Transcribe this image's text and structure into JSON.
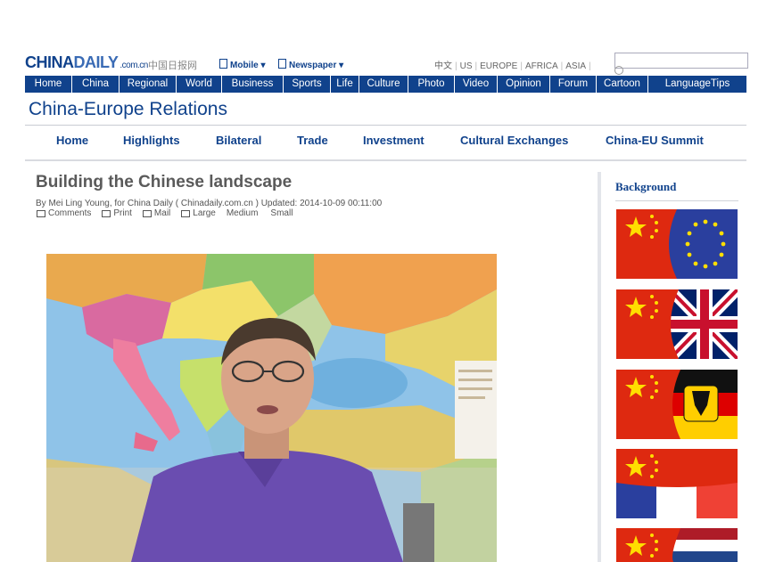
{
  "header": {
    "logo_main": "CHINA",
    "logo_daily": "DAILY",
    "logo_suffix": ".com.cn",
    "logo_chinese": "中国日报网",
    "mobile_label": "Mobile ▾",
    "newspaper_label": "Newspaper ▾",
    "regions": [
      "中文",
      "US",
      "EUROPE",
      "AFRICA",
      "ASIA"
    ],
    "search_placeholder": ""
  },
  "nav": {
    "items": [
      "Home",
      "China",
      "Regional",
      "World",
      "Business",
      "Sports",
      "Life",
      "Culture",
      "Photo",
      "Video",
      "Opinion",
      "Forum",
      "Cartoon",
      "LanguageTips"
    ]
  },
  "section": {
    "title": "China-Europe Relations",
    "subnav": [
      "Home",
      "Highlights",
      "Bilateral",
      "Trade",
      "Investment",
      "Cultural Exchanges",
      "China-EU Summit"
    ]
  },
  "article": {
    "headline": "Building the Chinese landscape",
    "byline": "By Mei Ling Young, for China Daily ( Chinadaily.com.cn ) Updated: 2014-10-09 00:11:00",
    "tools": [
      "Comments",
      "Print",
      "Mail"
    ],
    "font_sizes": [
      "Large",
      "Medium",
      "Small"
    ]
  },
  "sidebar": {
    "title": "Background"
  },
  "colors": {
    "brand_blue": "#10428c",
    "china_red": "#de2910",
    "china_yellow": "#ffde00"
  }
}
